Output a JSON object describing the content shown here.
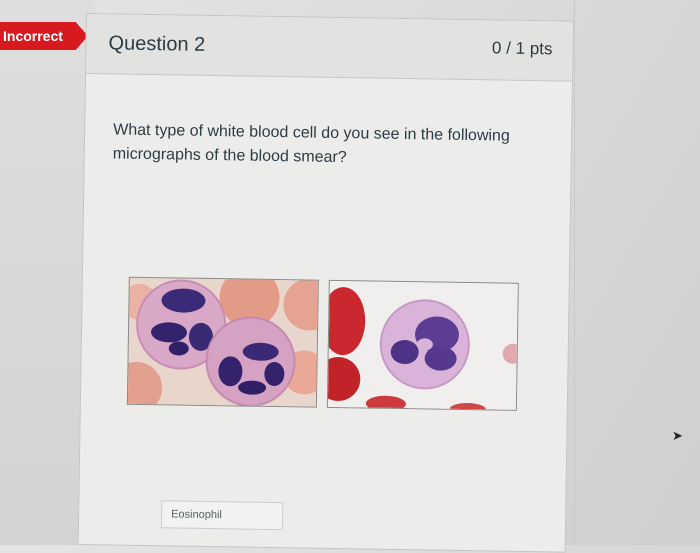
{
  "status_badge": {
    "label": "Incorrect",
    "color": "#d71920"
  },
  "question": {
    "title": "Question 2",
    "points": "0 / 1 pts",
    "text": "What type of white blood cell do you see in the following micrographs of the blood smear?"
  },
  "figure": {
    "panels": [
      "left micrograph",
      "right micrograph"
    ]
  },
  "answer": {
    "value": "Eosinophil"
  },
  "cursor": {
    "icon": "cursor-arrow-icon"
  }
}
